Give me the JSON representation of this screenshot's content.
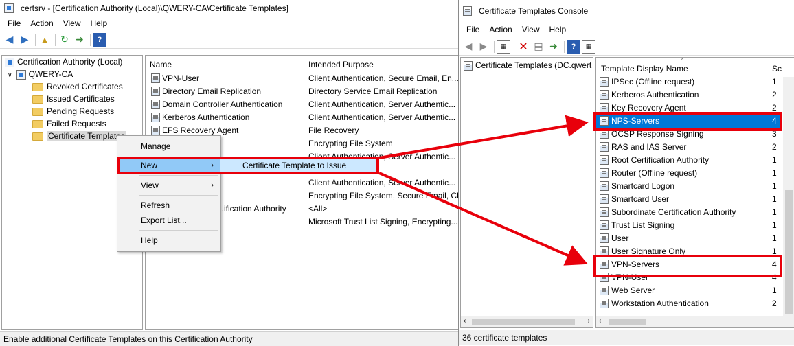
{
  "left_window": {
    "title": "certsrv - [Certification Authority (Local)\\QWERY-CA\\Certificate Templates]",
    "menu": [
      "File",
      "Action",
      "View",
      "Help"
    ],
    "tree": {
      "root": "Certification Authority (Local)",
      "ca": "QWERY-CA",
      "folders": [
        "Revoked Certificates",
        "Issued Certificates",
        "Pending Requests",
        "Failed Requests",
        "Certificate Templates"
      ]
    },
    "columns": {
      "name": "Name",
      "purpose": "Intended Purpose"
    },
    "rows": [
      {
        "name": "VPN-User",
        "purpose": "Client Authentication, Secure Email, En..."
      },
      {
        "name": "Directory Email Replication",
        "purpose": "Directory Service Email Replication"
      },
      {
        "name": "Domain Controller Authentication",
        "purpose": "Client Authentication, Server Authentic..."
      },
      {
        "name": "Kerberos Authentication",
        "purpose": "Client Authentication, Server Authentic..."
      },
      {
        "name": "EFS Recovery Agent",
        "purpose": "File Recovery"
      },
      {
        "name": "",
        "purpose": "Encrypting File System"
      },
      {
        "name": "",
        "purpose": "Client Authentication, Server Authentic..."
      },
      {
        "name": "",
        "purpose": "...n"
      },
      {
        "name": "",
        "purpose": "Client Authentication, Server Authentic..."
      },
      {
        "name": "",
        "purpose": "Encrypting File System, Secure Email, Cl..."
      },
      {
        "name": "...ification Authority",
        "purpose": "<All>"
      },
      {
        "name": "",
        "purpose": "Microsoft Trust List Signing, Encrypting..."
      }
    ],
    "status": "Enable additional Certificate Templates on this Certification Authority"
  },
  "context_menu": {
    "items": [
      "Manage",
      "New",
      "View",
      "Refresh",
      "Export List...",
      "Help"
    ],
    "submenu_item": "Certificate Template to Issue"
  },
  "right_window": {
    "title": "Certificate Templates Console",
    "menu": [
      "File",
      "Action",
      "View",
      "Help"
    ],
    "tree_node": "Certificate Templates (DC.qwert",
    "columns": {
      "name": "Template Display Name",
      "schema": "Sc"
    },
    "rows": [
      {
        "name": "IPSec (Offline request)",
        "schema": "1"
      },
      {
        "name": "Kerberos Authentication",
        "schema": "2"
      },
      {
        "name": "Key Recovery Agent",
        "schema": "2"
      },
      {
        "name": "NPS-Servers",
        "schema": "4"
      },
      {
        "name": "OCSP Response Signing",
        "schema": "3"
      },
      {
        "name": "RAS and IAS Server",
        "schema": "2"
      },
      {
        "name": "Root Certification Authority",
        "schema": "1"
      },
      {
        "name": "Router (Offline request)",
        "schema": "1"
      },
      {
        "name": "Smartcard Logon",
        "schema": "1"
      },
      {
        "name": "Smartcard User",
        "schema": "1"
      },
      {
        "name": "Subordinate Certification Authority",
        "schema": "1"
      },
      {
        "name": "Trust List Signing",
        "schema": "1"
      },
      {
        "name": "User",
        "schema": "1"
      },
      {
        "name": "User Signature Only",
        "schema": "1"
      },
      {
        "name": "VPN-Servers",
        "schema": "4"
      },
      {
        "name": "VPN-User",
        "schema": "4"
      },
      {
        "name": "Web Server",
        "schema": "1"
      },
      {
        "name": "Workstation Authentication",
        "schema": "2"
      }
    ],
    "status": "36 certificate templates"
  },
  "annotation_color": "#e8000b",
  "selection_color": "#0078d7"
}
